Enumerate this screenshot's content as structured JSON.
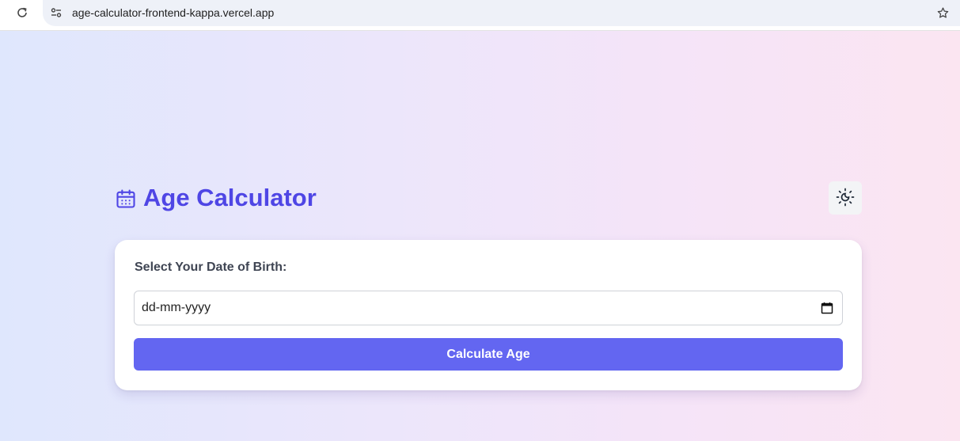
{
  "browser": {
    "url": "age-calculator-frontend-kappa.vercel.app",
    "icons": {
      "reload": "reload-icon",
      "site_info": "tune-icon",
      "bookmark": "star-icon"
    }
  },
  "app": {
    "title": "Age Calculator",
    "title_icon": "calendar-icon",
    "theme_toggle_icon": "sun-moon-icon",
    "accent_color": "#4f46e5",
    "button_color": "#6366f1"
  },
  "form": {
    "dob_label": "Select Your Date of Birth:",
    "dob_placeholder": "dd-mm-yyyy",
    "calculate_label": "Calculate Age"
  }
}
